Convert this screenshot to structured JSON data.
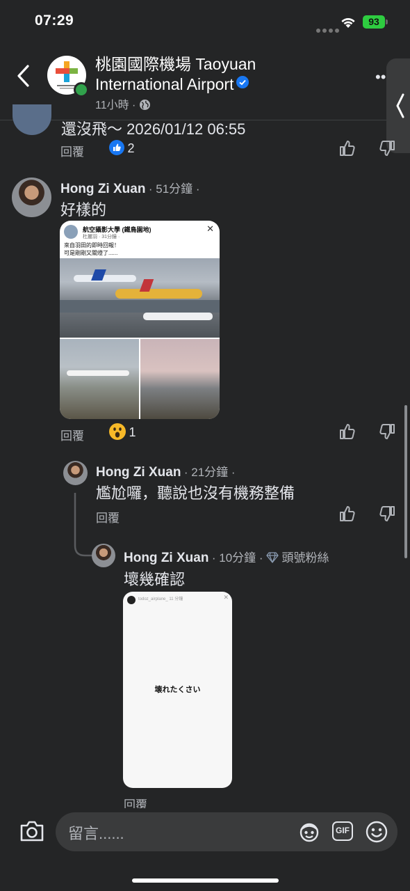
{
  "status_bar": {
    "time": "07:29",
    "battery": "93"
  },
  "header": {
    "page_name": "桃園國際機場 Taoyuan International Airport",
    "post_time": "11小時 · "
  },
  "top_comment": {
    "text_partial": "還沒飛～ 2026/01/12 06:55",
    "reply_label": "回覆",
    "like_count": "2"
  },
  "comments": [
    {
      "author": "Hong Zi Xuan",
      "time": "· 51分鐘 ·",
      "text": "好樣的",
      "reply_label": "回覆",
      "reaction_count": "1",
      "shared_post": {
        "title": "航空攝影大學 (鐵鳥園地)",
        "meta": "杜麗羽 · 31分鐘 · ",
        "line1": "來自羽田的即時回報！",
        "line2": "可是剛剛又關燈了......"
      }
    },
    {
      "author": "Hong Zi Xuan",
      "time": "· 21分鐘 ·",
      "text": "尷尬囉，聽說也沒有機務整備",
      "reply_label": "回覆"
    },
    {
      "author": "Hong Zi Xuan",
      "time": "· 10分鐘 ·",
      "badge": "頭號粉絲",
      "text": "壞幾確認",
      "reply_label": "回覆",
      "story": {
        "account": "todoz_airplane_",
        "age": "11 分鐘",
        "text": "壊れたくさい"
      }
    }
  ],
  "composer": {
    "placeholder": "留言......",
    "gif_label": "GIF"
  },
  "icons": [
    "back-icon",
    "more-icon",
    "globe-icon",
    "verified-icon",
    "like-icon",
    "dislike-icon",
    "wow-icon",
    "camera-icon",
    "avatar-sticker-icon",
    "gif-icon",
    "emoji-icon",
    "diamond-icon",
    "wifi-icon",
    "handle-chevron-icon"
  ]
}
